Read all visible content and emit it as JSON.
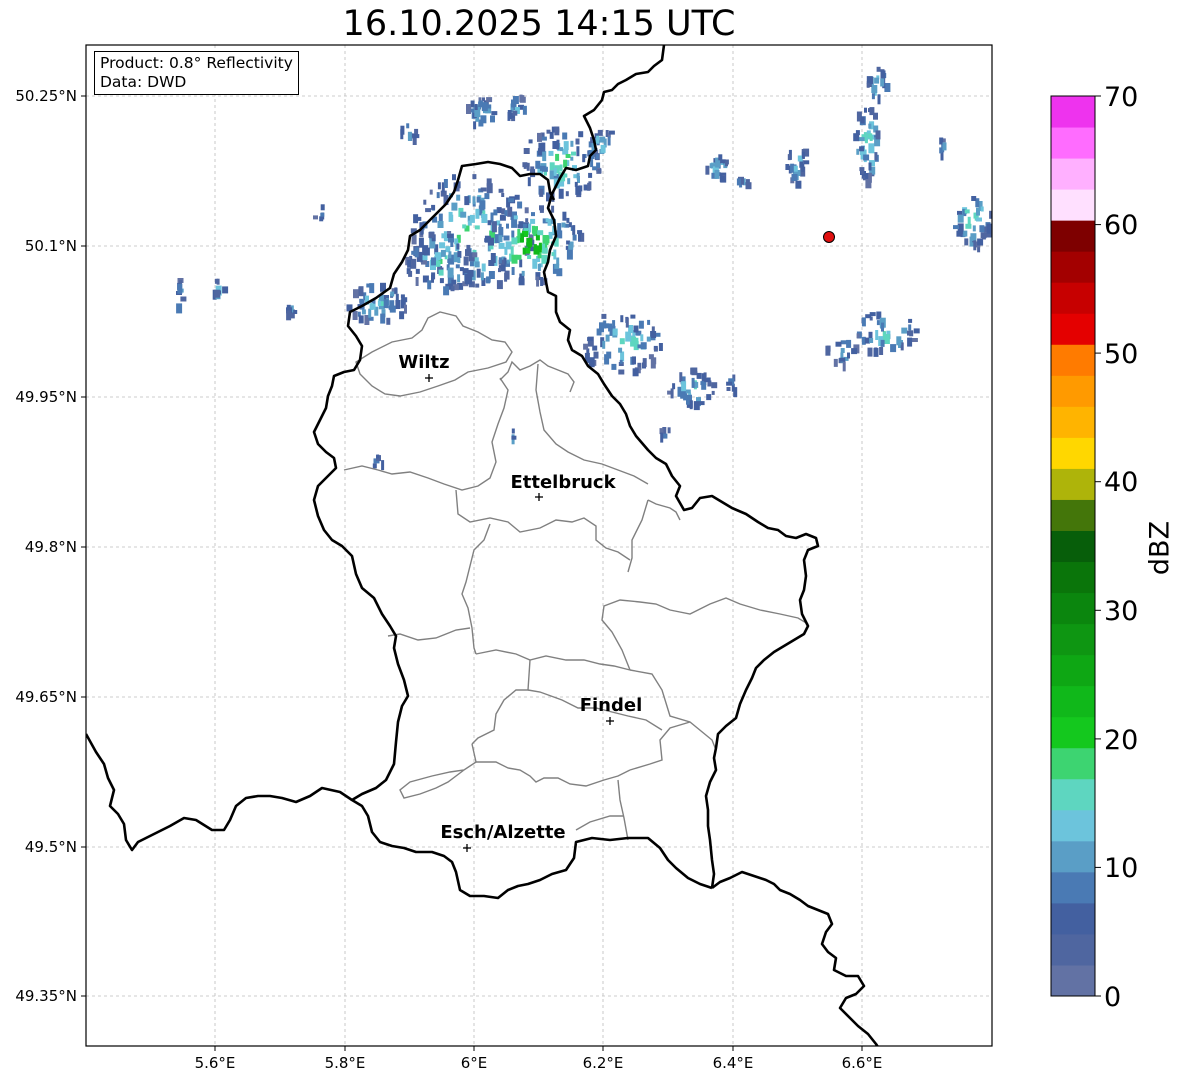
{
  "title": "16.10.2025 14:15 UTC",
  "info": {
    "product": "Product: 0.8° Reflectivity",
    "source": "Data: DWD"
  },
  "colorbar": {
    "label": "dBZ",
    "ticks": [
      "0",
      "10",
      "20",
      "30",
      "40",
      "50",
      "60",
      "70"
    ],
    "min": 0,
    "max": 70,
    "step": 2.5,
    "colors": [
      "#6272a4",
      "#4f66a0",
      "#4360a0",
      "#4a7ab4",
      "#5a9ec6",
      "#6cc4dc",
      "#5ed6c0",
      "#3dd471",
      "#14c81e",
      "#10b81a",
      "#0ea714",
      "#0e9612",
      "#0b860e",
      "#0a750a",
      "#075e0a",
      "#44760a",
      "#aeb40a",
      "#ffd700",
      "#ffb400",
      "#ff9a00",
      "#ff7b00",
      "#e40000",
      "#c70000",
      "#a30000",
      "#7e0000",
      "#ffe0ff",
      "#ffb0ff",
      "#ff6cff",
      "#ee33ee"
    ]
  },
  "axes": {
    "lat_labels": [
      "50.25°N",
      "50.1°N",
      "49.95°N",
      "49.8°N",
      "49.65°N",
      "49.5°N",
      "49.35°N"
    ],
    "lon_labels": [
      "5.6°E",
      "5.8°E",
      "6°E",
      "6.2°E",
      "6.4°E",
      "6.6°E"
    ]
  },
  "cities": [
    {
      "name": "Wiltz"
    },
    {
      "name": "Ettelbruck"
    },
    {
      "name": "Findel"
    },
    {
      "name": "Esch/Alzette"
    }
  ],
  "radar_site": {
    "color": "#e01010"
  }
}
